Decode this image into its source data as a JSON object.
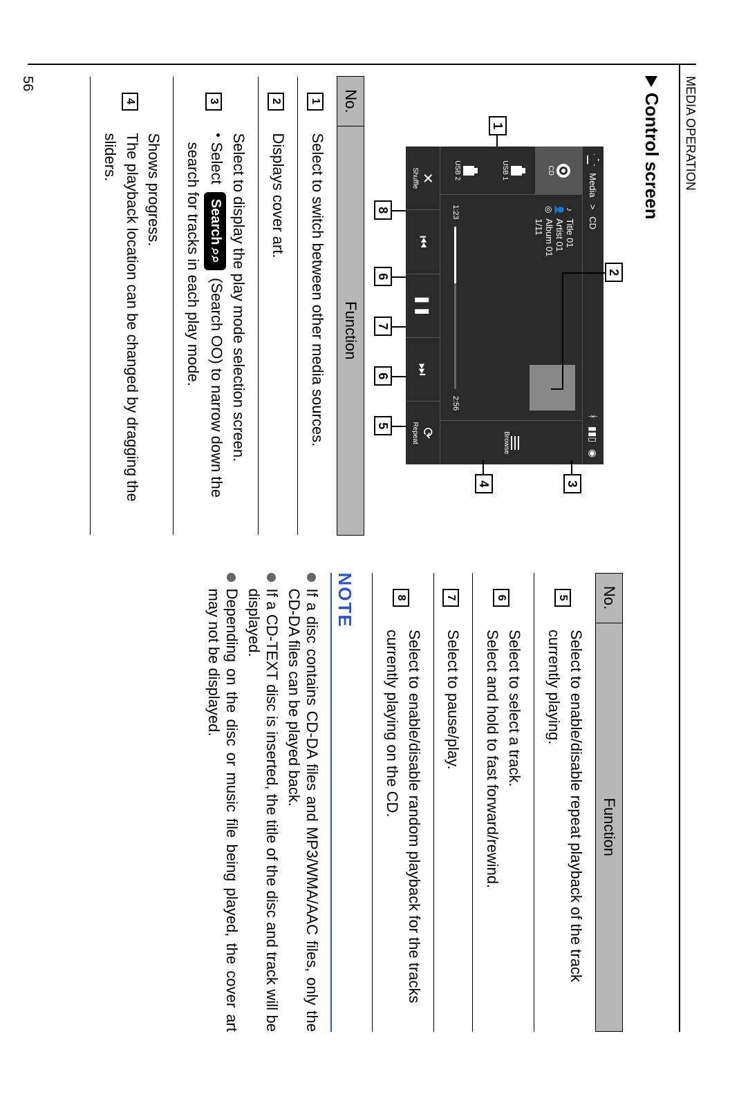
{
  "header": "MEDIA OPERATION",
  "section_title": "Control screen",
  "page_number": "56",
  "mock": {
    "breadcrumb_media": "Media",
    "breadcrumb_sep": ">",
    "breadcrumb_cd": "CD",
    "source_cd": "CD",
    "source_usb1": "USB 1",
    "source_usb2": "USB 2",
    "track": "Title 01",
    "artist": "Artist 01",
    "album": "Album 01",
    "track_count": "1/11",
    "elapsed": "1:23",
    "remaining": "2:56",
    "browse": "Browse",
    "shuffle": "Shuffle",
    "repeat": "Repeat"
  },
  "callouts": {
    "c1": "1",
    "c2": "2",
    "c3": "3",
    "c4": "4",
    "c5": "5",
    "c6": "6",
    "c7": "7",
    "c8": "8"
  },
  "table_headers": {
    "no": "No.",
    "function": "Function"
  },
  "table1": {
    "r1": {
      "num": "1",
      "text": "Select to switch between other media sources."
    },
    "r2": {
      "num": "2",
      "text": "Displays cover art."
    },
    "r3": {
      "num": "3",
      "line1": "Select to display the play mode selection screen.",
      "bullet_pre": "Select",
      "chip_label": "Search",
      "chip_icon": "⌕⌕",
      "bullet_mid": "(Search OO) to narrow down the search for tracks in each play mode."
    },
    "r4": {
      "num": "4",
      "line1": "Shows progress.",
      "line2": "The playback location can be changed by dragging the sliders."
    }
  },
  "table2": {
    "r5": {
      "num": "5",
      "text": "Select to enable/disable repeat playback of the track currently playing."
    },
    "r6": {
      "num": "6",
      "line1": "Select to select a track.",
      "line2": "Select and hold to fast forward/rewind."
    },
    "r7": {
      "num": "7",
      "text": "Select to pause/play."
    },
    "r8": {
      "num": "8",
      "text": "Select to enable/disable random playback for the tracks currently playing on the CD."
    }
  },
  "note_title": "NOTE",
  "notes": {
    "n1": "If a disc contains CD-DA files and MP3/WMA/AAC files, only the CD-DA files can be played back.",
    "n2": "If a CD-TEXT disc is inserted, the title of the disc and track will be displayed.",
    "n3": "Depending on the disc or music file being played, the cover art may not be displayed."
  }
}
